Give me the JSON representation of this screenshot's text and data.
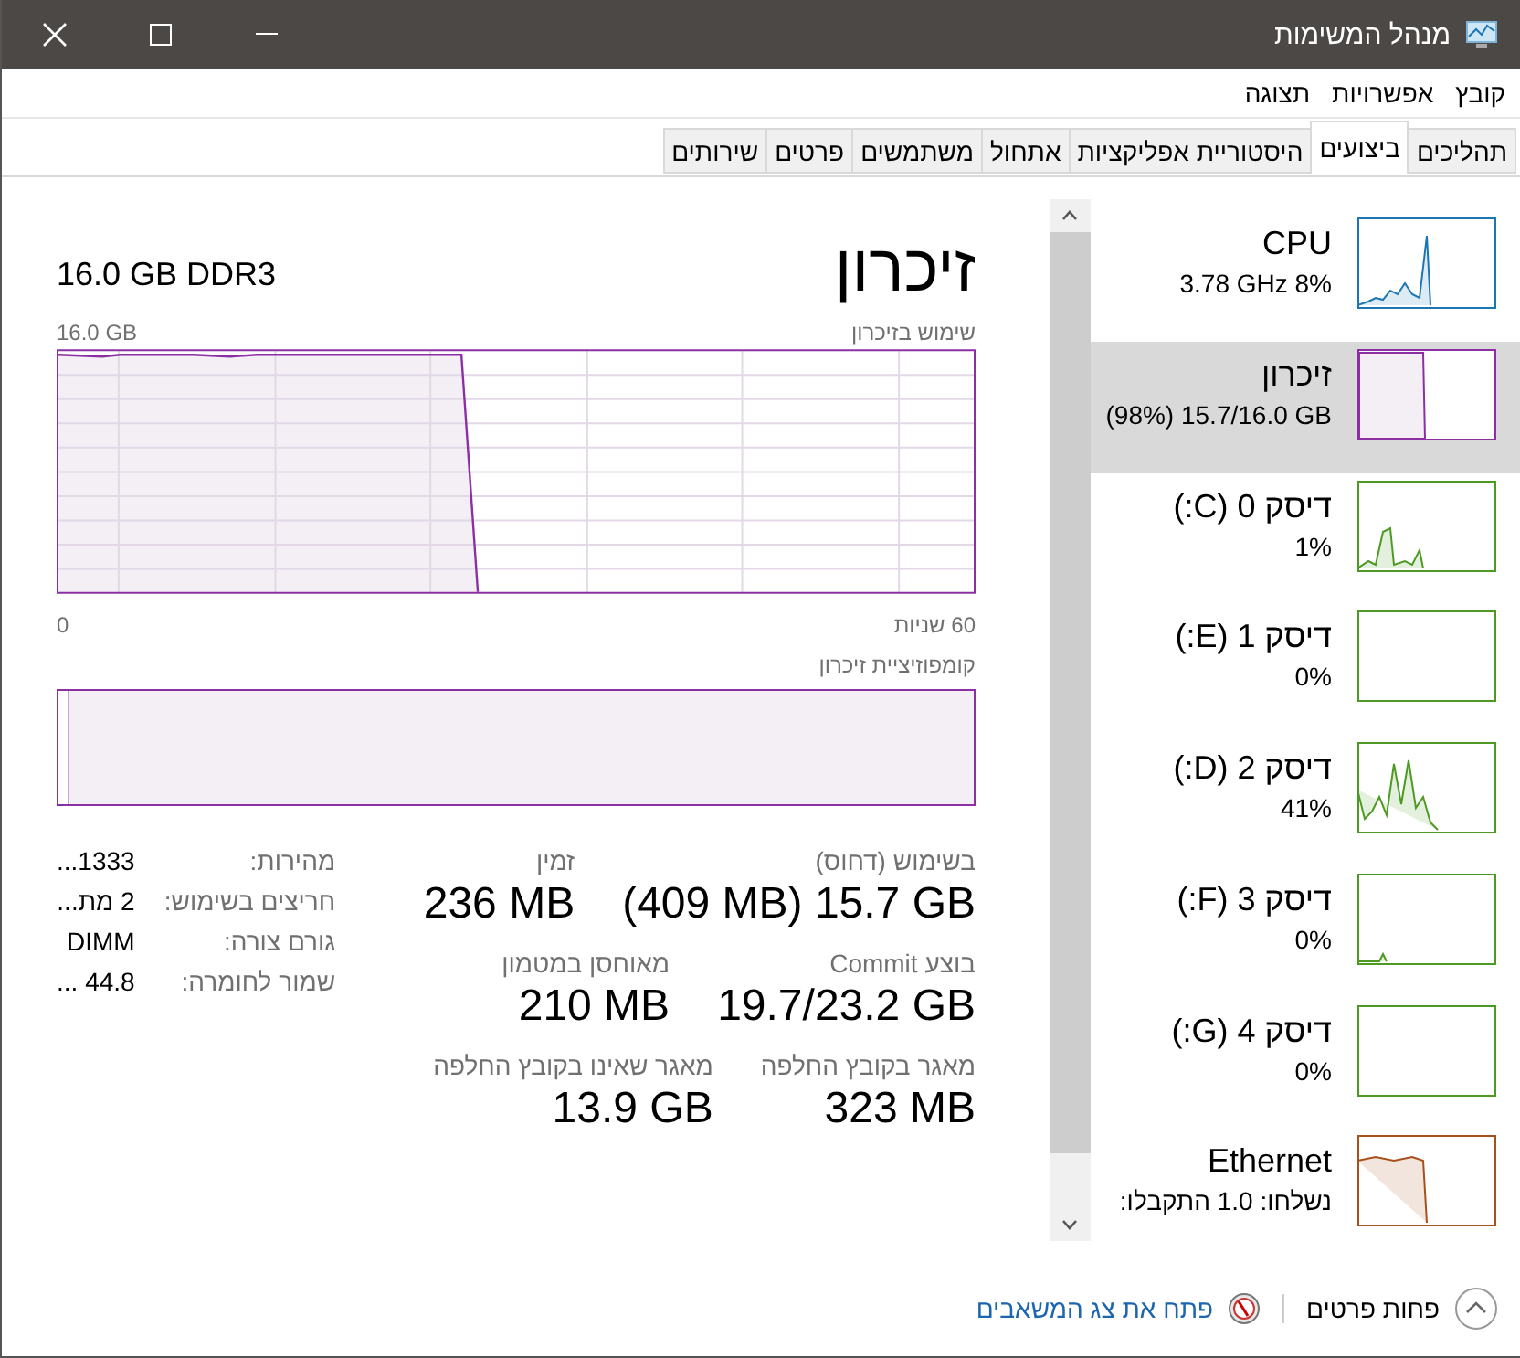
{
  "window": {
    "title": "מנהל המשימות"
  },
  "menu": [
    "קובץ",
    "אפשרויות",
    "תצוגה"
  ],
  "tabs": [
    {
      "label": "תהליכים",
      "selected": false
    },
    {
      "label": "ביצועים",
      "selected": true
    },
    {
      "label": "היסטוריית אפליקציות",
      "selected": false
    },
    {
      "label": "אתחול",
      "selected": false
    },
    {
      "label": "משתמשים",
      "selected": false
    },
    {
      "label": "פרטים",
      "selected": false
    },
    {
      "label": "שירותים",
      "selected": false
    }
  ],
  "sidebar": {
    "items": [
      {
        "name": "CPU",
        "detail": "3.78 GHz 8%",
        "color": "#1b76b3",
        "selected": false
      },
      {
        "name": "זיכרון",
        "detail": "(98%) 15.7/16.0 GB",
        "color": "#8b2fa3",
        "selected": true
      },
      {
        "name": "דיסק 0 (C:)",
        "detail": "1%",
        "color": "#4d9a22",
        "selected": false
      },
      {
        "name": "דיסק 1 (E:)",
        "detail": "0%",
        "color": "#4d9a22",
        "selected": false
      },
      {
        "name": "דיסק 2 (D:)",
        "detail": "41%",
        "color": "#4d9a22",
        "selected": false
      },
      {
        "name": "דיסק 3 (F:)",
        "detail": "0%",
        "color": "#4d9a22",
        "selected": false
      },
      {
        "name": "דיסק 4 (G:)",
        "detail": "0%",
        "color": "#4d9a22",
        "selected": false
      },
      {
        "name": "Ethernet",
        "detail": "נשלחו: 1.0 התקבלו:",
        "color": "#a7501a",
        "selected": false
      }
    ]
  },
  "details": {
    "title": "זיכרון",
    "capacity": "16.0 GB DDR3",
    "usage_label": "שימוש בזיכרון",
    "usage_max": "16.0 GB",
    "axis_start": "60 שניות",
    "axis_end": "0",
    "composition_label": "קומפוזיציית זיכרון",
    "stats": [
      {
        "label": "בשימוש (דחוס)",
        "value": "(409 MB) 15.7 GB"
      },
      {
        "label": "זמין",
        "value": "236 MB"
      },
      {
        "label": "בוצע Commit",
        "value": "19.7/23.2 GB"
      },
      {
        "label": "מאוחסן במטמון",
        "value": "210 MB"
      },
      {
        "label": "מאגר בקובץ החלפה",
        "value": "323 MB"
      },
      {
        "label": "מאגר שאינו בקובץ החלפה",
        "value": "13.9 GB"
      }
    ],
    "specs": [
      {
        "label": "מהירות:",
        "value": "1333..."
      },
      {
        "label": "חריצים בשימוש:",
        "value": "2 מת..."
      },
      {
        "label": "גורם צורה:",
        "value": "DIMM"
      },
      {
        "label": "שמור לחומרה:",
        "value": "44.8 ..."
      }
    ]
  },
  "footer": {
    "fewer_details": "פחות פרטים",
    "open_monitor": "פתח את צג המשאבים"
  }
}
